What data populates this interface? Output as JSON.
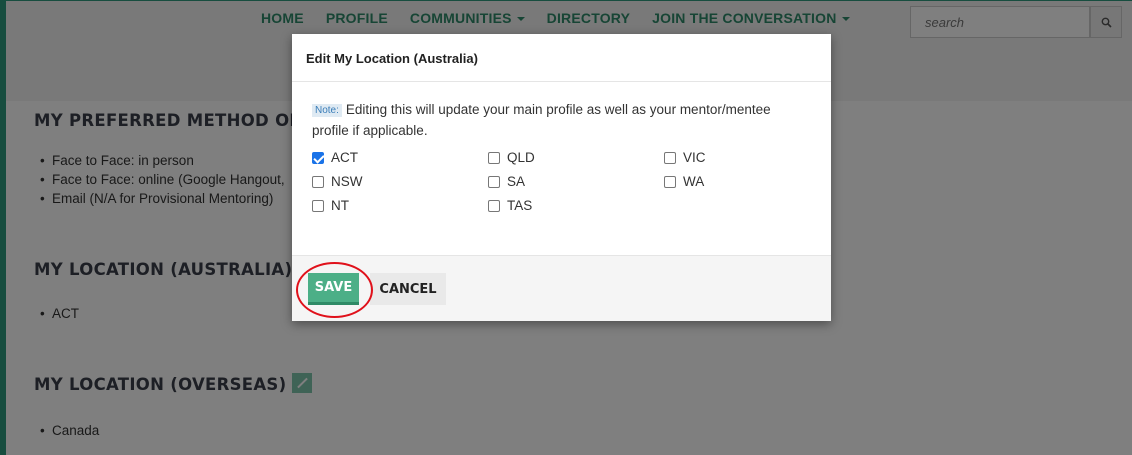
{
  "nav": {
    "items": [
      {
        "label": "HOME",
        "dropdown": false
      },
      {
        "label": "PROFILE",
        "dropdown": false
      },
      {
        "label": "COMMUNITIES",
        "dropdown": true
      },
      {
        "label": "DIRECTORY",
        "dropdown": false
      },
      {
        "label": "JOIN THE CONVERSATION",
        "dropdown": true
      }
    ],
    "search_placeholder": "search",
    "search_icon": "search-icon"
  },
  "page": {
    "preferred_method": {
      "heading": "MY PREFERRED METHOD OF CO",
      "items": [
        "Face to Face: in person",
        "Face to Face: online (Google Hangout, ",
        "Email (N/A for Provisional Mentoring)"
      ]
    },
    "location_au": {
      "heading": "MY LOCATION (AUSTRALIA)",
      "items": [
        "ACT"
      ]
    },
    "location_overseas": {
      "heading": "MY LOCATION (OVERSEAS)",
      "items": [
        "Canada"
      ]
    }
  },
  "modal": {
    "title": "Edit My Location (Australia)",
    "note_tag": "Note:",
    "note_text": "Editing this will update your main profile as well as your mentor/mentee profile if applicable.",
    "options": [
      {
        "label": "ACT",
        "checked": true
      },
      {
        "label": "QLD",
        "checked": false
      },
      {
        "label": "VIC",
        "checked": false
      },
      {
        "label": "NSW",
        "checked": false
      },
      {
        "label": "SA",
        "checked": false
      },
      {
        "label": "WA",
        "checked": false
      },
      {
        "label": "NT",
        "checked": false
      },
      {
        "label": "TAS",
        "checked": false
      }
    ],
    "save_label": "SAVE",
    "cancel_label": "CANCEL"
  },
  "colors": {
    "brand": "#2e8b6a",
    "save_button": "#4caf87",
    "highlight": "#e0111b",
    "checkbox_checked": "#1a73e8"
  }
}
